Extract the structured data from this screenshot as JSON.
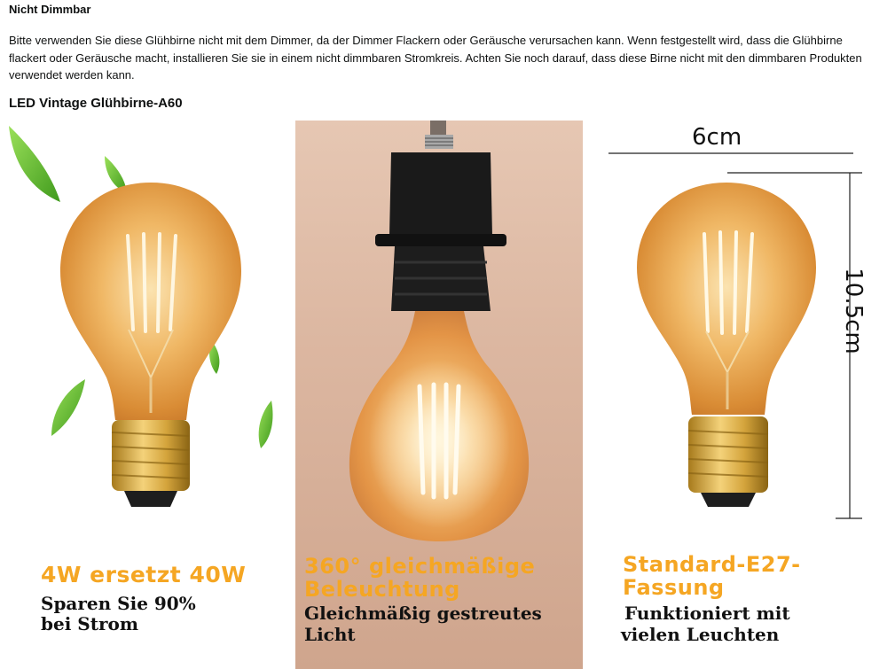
{
  "section": {
    "title": "Nicht Dimmbar",
    "description": "Bitte verwenden Sie diese Glühbirne nicht mit dem Dimmer, da der Dimmer Flackern oder Geräusche verursachen kann. Wenn festgestellt wird, dass die Glühbirne flackert oder Geräusche macht, installieren Sie sie in einem nicht dimmbaren Stromkreis. Achten Sie noch darauf, dass diese Birne nicht mit den dimmbaren Produkten verwendet werden kann."
  },
  "product": {
    "title": "LED Vintage Glühbirne-A60"
  },
  "panels": [
    {
      "headline_line1": "4W ersetzt 40W",
      "subtext_line1": "Sparen Sie 90%",
      "subtext_line2": "bei Strom"
    },
    {
      "headline_line1": "360° gleichmäßige",
      "headline_line2": "Beleuchtung",
      "subtext_line1": "Gleichmäßig gestreutes",
      "subtext_line2": "Licht"
    },
    {
      "headline_line1": "Standard-E27-",
      "headline_line2": "Fassung",
      "subtext_line1": "Funktioniert mit",
      "subtext_line2": "vielen Leuchten",
      "width_label": "6cm",
      "height_label": "10.5cm"
    }
  ],
  "colors": {
    "caption_orange": "#f5a623",
    "glass_amber": "#e8a54a",
    "leaf_green": "#5cb82e",
    "socket_black": "#1a1a1a"
  },
  "icons": [
    "leaf-icon",
    "bulb-icon"
  ]
}
